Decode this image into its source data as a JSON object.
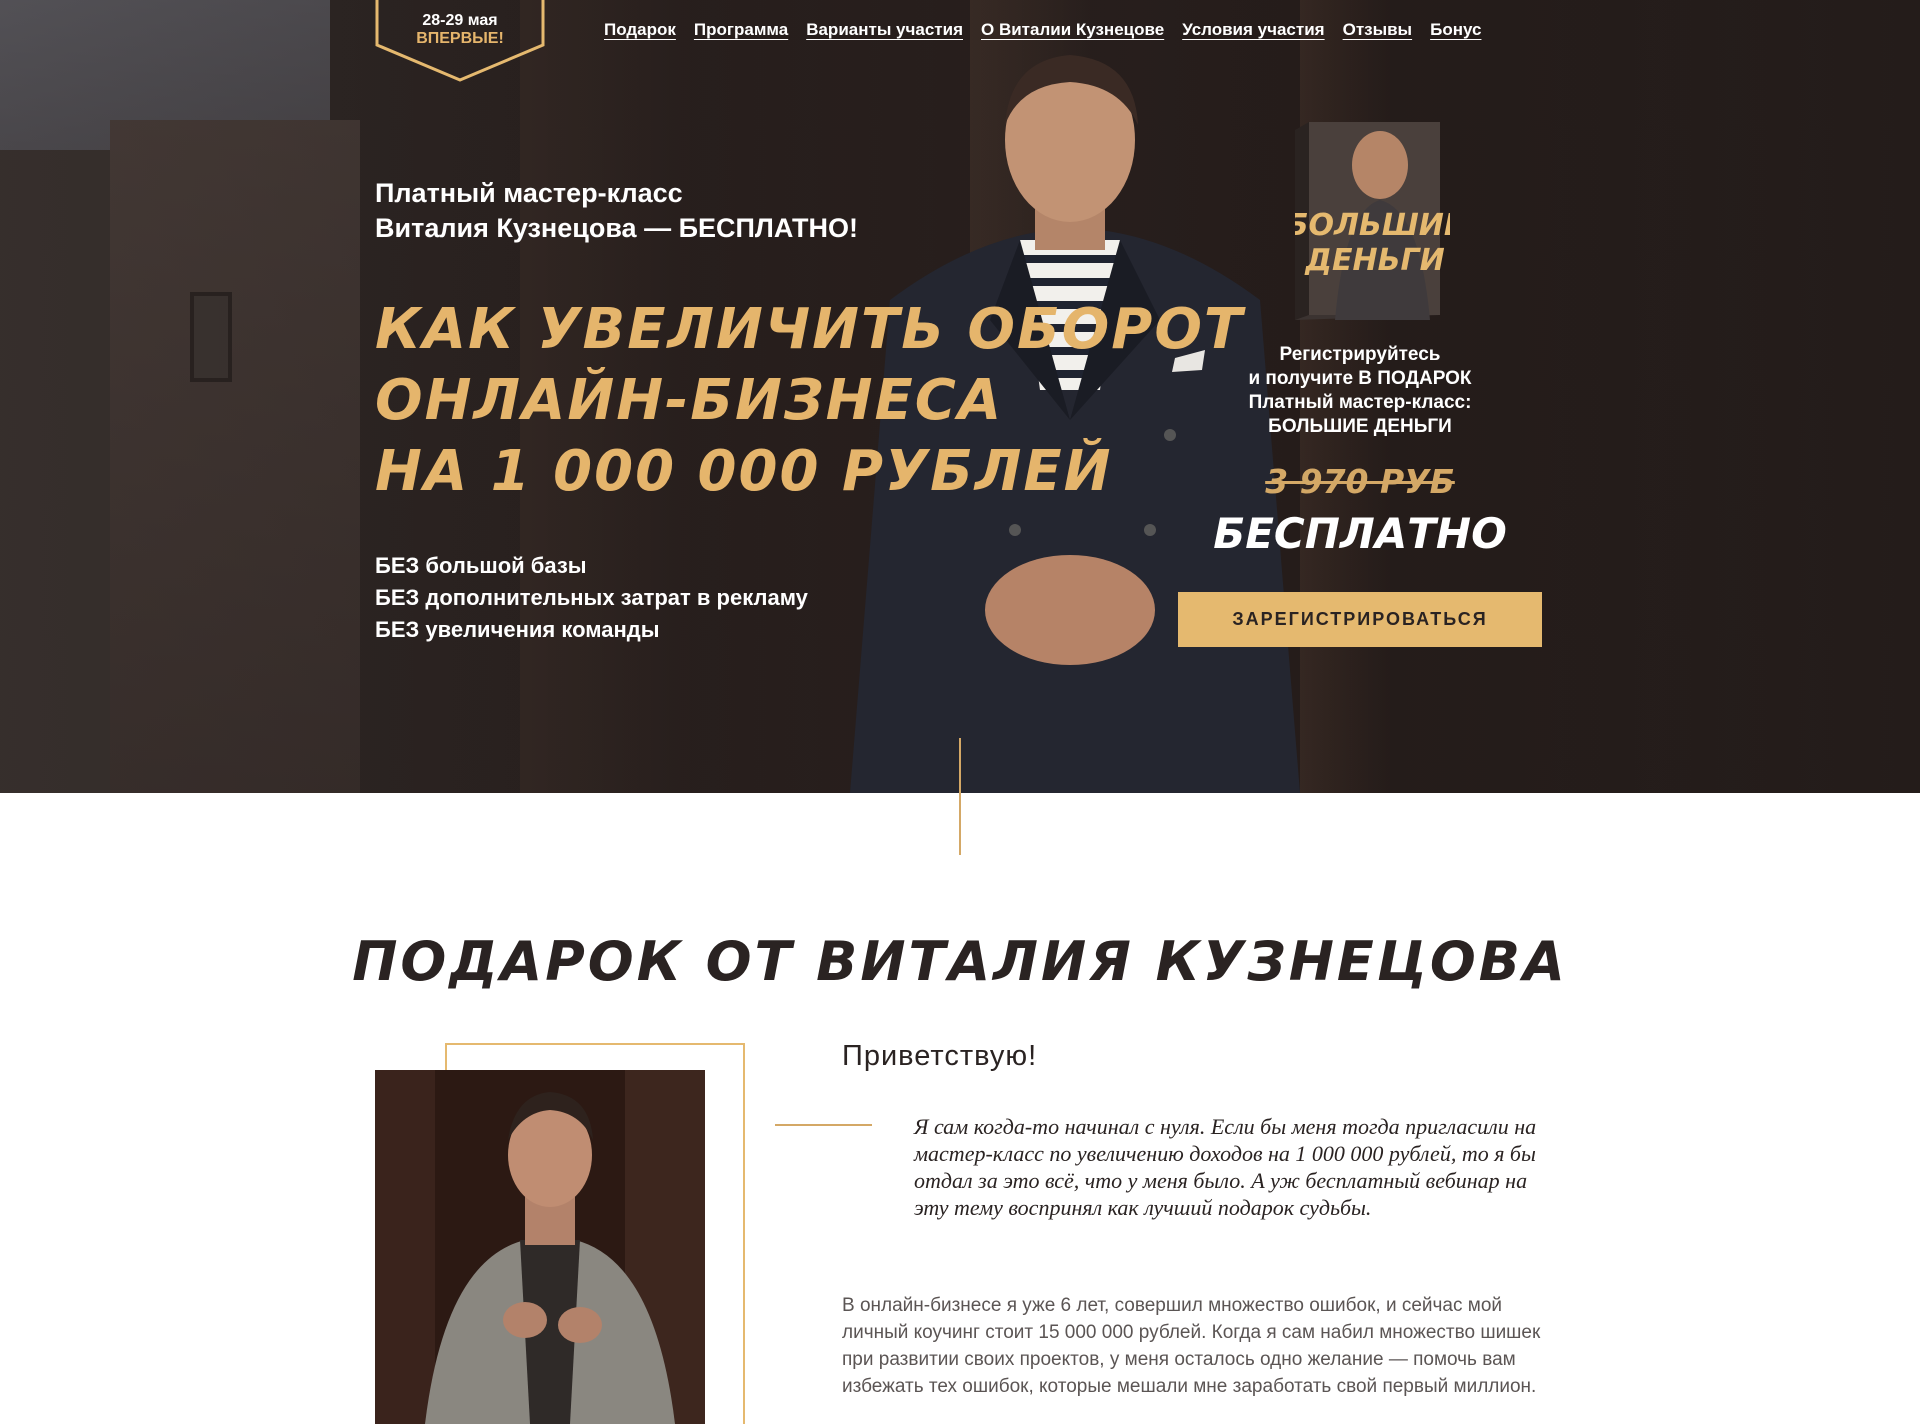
{
  "badge": {
    "date": "28-29 мая",
    "label": "ВПЕРВЫЕ!"
  },
  "nav": {
    "items": [
      "Подарок",
      "Программа",
      "Варианты участия",
      "О Виталии Кузнецове",
      "Условия участия",
      "Отзывы",
      "Бонус"
    ]
  },
  "hero": {
    "subhead_line1": "Платный мастер-класс",
    "subhead_line2": "Виталия Кузнецова — БЕСПЛАТНО!",
    "headline_line1": "КАК УВЕЛИЧИТЬ ОБОРОТ",
    "headline_line2": "ОНЛАЙН-БИЗНЕСА",
    "headline_line3": "НА 1 000 000 РУБЛЕЙ",
    "bullets": [
      "БЕЗ большой базы",
      "БЕЗ дополнительных затрат в рекламу",
      "БЕЗ увеличения команды"
    ]
  },
  "offer": {
    "box_title_line1": "БОЛЬШИЕ",
    "box_title_line2": "ДЕНЬГИ",
    "gift_line1": "Регистрируйтесь",
    "gift_line2": "и получите В ПОДАРОК",
    "gift_line3": "Платный мастер-класс:",
    "gift_line4": "БОЛЬШИЕ ДЕНЬГИ",
    "old_price": "3 970 РУБ",
    "free_label": "БЕСПЛАТНО",
    "register_button": "ЗАРЕГИСТРИРОВАТЬСЯ"
  },
  "gift_section": {
    "title": "ПОДАРОК ОТ ВИТАЛИЯ КУЗНЕЦОВА",
    "greeting": "Приветствую!",
    "quote": "Я сам когда-то начинал с нуля. Если бы меня тогда пригласили на мастер-класс по увеличению доходов на 1 000 000 рублей, то я бы отдал за это всё, что у меня было. А уж бесплатный вебинар на эту тему воспринял как лучший подарок судьбы.",
    "paragraph": "В онлайн-бизнесе я уже 6 лет, совершил множество ошибок, и сейчас мой личный коучинг стоит 15 000 000 рублей. Когда я сам набил множество шишек при развитии своих проектов, у меня осталось одно желание — помочь вам избежать тех ошибок, которые мешали мне заработать свой первый миллион."
  },
  "colors": {
    "accent": "#e5b96f",
    "dark": "#2a2322",
    "hero_bg": "#2b2220"
  }
}
